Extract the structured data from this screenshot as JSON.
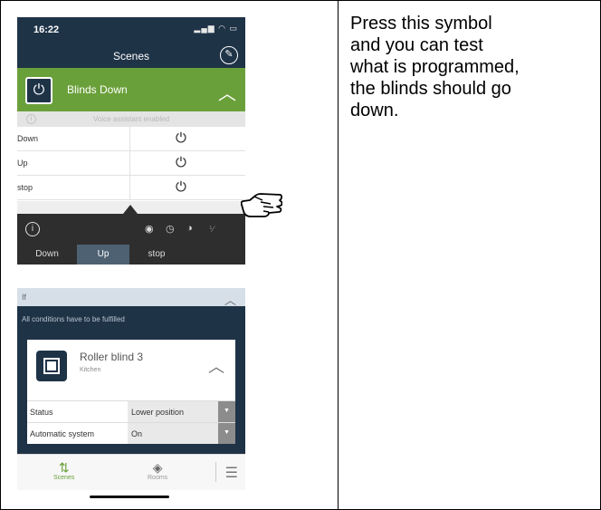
{
  "status_bar": {
    "time": "16:22",
    "system_icons": "signal-wifi-battery"
  },
  "nav": {
    "title": "Scenes",
    "edit_icon": "pencil-icon"
  },
  "scene": {
    "name": "Blinds Down",
    "icon": "power-icon"
  },
  "voice_assistant": {
    "text": "Voice assistant enabled"
  },
  "actions": [
    {
      "label": "Down",
      "button": "⏻"
    },
    {
      "label": "Up",
      "button": "⏻"
    },
    {
      "label": "stop",
      "button": "⏻"
    }
  ],
  "mode_icons": [
    "◉",
    "◷",
    "◑",
    "⅟"
  ],
  "tabs": [
    {
      "label": "Down"
    },
    {
      "label": "Up"
    },
    {
      "label": "stop"
    }
  ],
  "active_tab": "Up",
  "if_section": {
    "label": "If",
    "conditions_text": "All conditions have to be fulfilled"
  },
  "device": {
    "name": "Roller blind 3",
    "room": "Kitchen",
    "properties": [
      {
        "key": "Status",
        "value": "Lower position"
      },
      {
        "key": "Automatic system",
        "value": "On"
      }
    ]
  },
  "bottom_nav": {
    "scenes_label": "Scenes",
    "rooms_label": "Rooms"
  },
  "instruction": {
    "lines": [
      "Press this symbol",
      "and you can test",
      "what is programmed,",
      "the blinds should go",
      "down."
    ]
  },
  "colors": {
    "navy": "#1f3347",
    "green": "#6aa03a",
    "dark": "#2e2e2e"
  }
}
